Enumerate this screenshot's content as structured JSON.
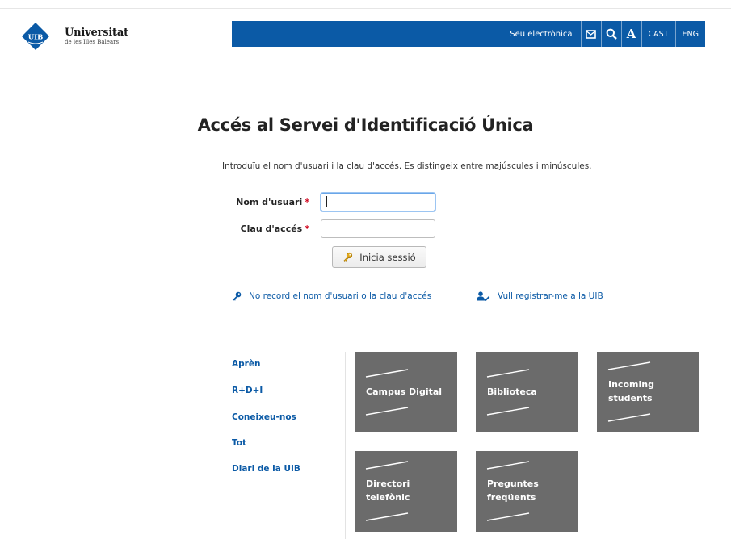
{
  "logo": {
    "badge": "UIB",
    "name": "Universitat",
    "subtitle": "de les Illes Balears"
  },
  "topnav": {
    "seu_label": "Seu electrònica",
    "mail_icon": "envelope-icon",
    "search_icon": "search-icon",
    "font_label": "A",
    "lang_cast": "CAST",
    "lang_eng": "ENG"
  },
  "page": {
    "title": "Accés al Servei d'Identificació Única",
    "intro": "Introduïu el nom d'usuari i la clau d'accés. Es distingeix entre majúscules i minúscules."
  },
  "form": {
    "username_label": "Nom d'usuari",
    "username_value": "",
    "password_label": "Clau d'accés",
    "password_value": "",
    "required_mark": "*",
    "login_label": "Inicia sessió"
  },
  "links": {
    "forgot": "No record el nom d'usuari o la clau d'accés",
    "register": "Vull registrar-me a la UIB"
  },
  "side_menu": [
    "Aprèn",
    "R+D+I",
    "Coneixeu-nos",
    "Tot",
    "Diari de la UIB"
  ],
  "tiles": [
    {
      "line1": "Campus Digital",
      "line2": ""
    },
    {
      "line1": "Biblioteca",
      "line2": ""
    },
    {
      "line1": "Incoming",
      "line2": "students"
    },
    {
      "line1": "Directori",
      "line2": "telefònic"
    },
    {
      "line1": "Preguntes",
      "line2": "freqüents"
    }
  ],
  "colors": {
    "brand_blue": "#0b5aa6",
    "tile_gray": "#6b6b6b",
    "required_red": "#d0021b"
  }
}
